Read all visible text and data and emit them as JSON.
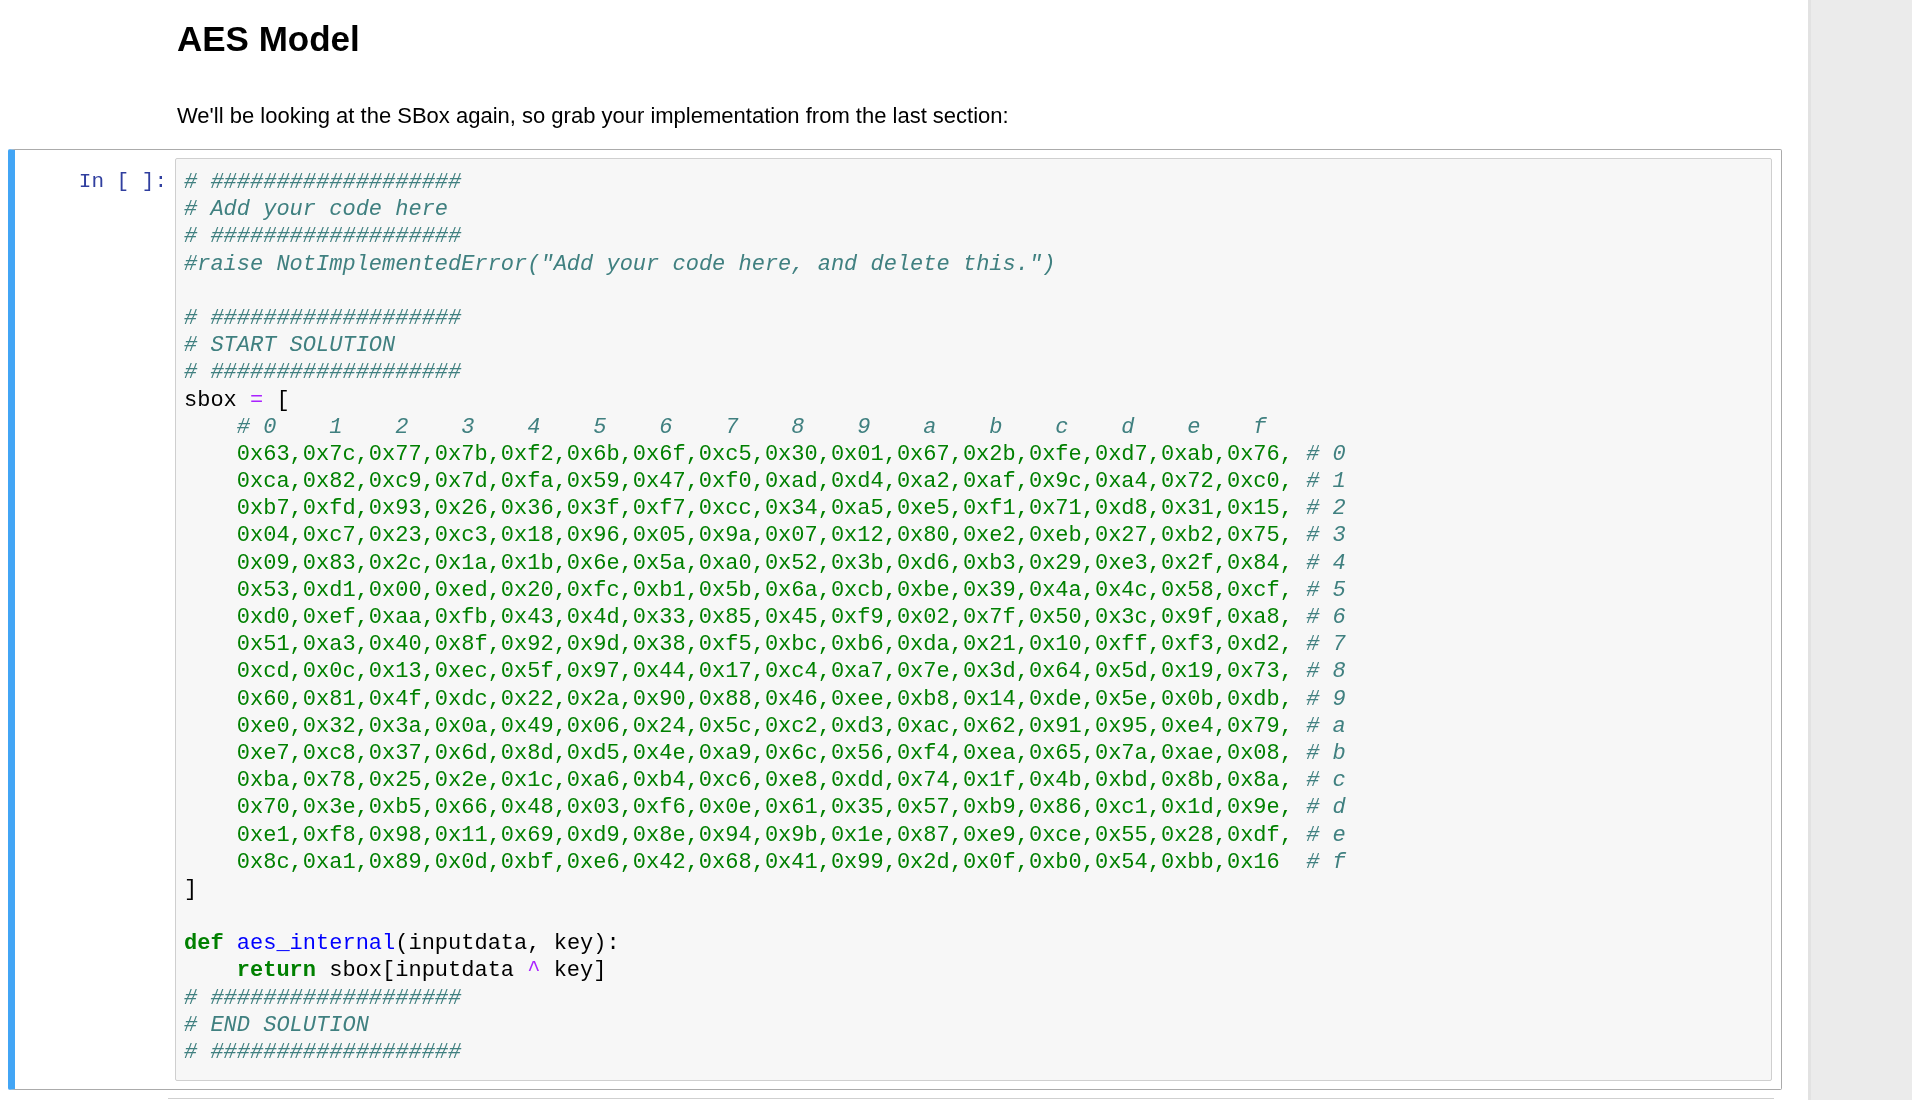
{
  "heading": "AES Model",
  "paragraph": "We'll be looking at the SBox again, so grab your implementation from the last section:",
  "cell": {
    "prompt": "In [ ]:",
    "active": true,
    "blocks": [
      {
        "lines": [
          {
            "segments": [
              {
                "kind": "comment",
                "text": "# ###################"
              }
            ]
          },
          {
            "segments": [
              {
                "kind": "comment",
                "text": "# Add your code here"
              }
            ]
          },
          {
            "segments": [
              {
                "kind": "comment",
                "text": "# ###################"
              }
            ]
          },
          {
            "segments": [
              {
                "kind": "comment",
                "text": "#raise NotImplementedError(\"Add your code here, and delete this.\")"
              }
            ]
          }
        ]
      },
      {
        "lines": [
          {
            "segments": [
              {
                "kind": "comment",
                "text": "# ###################"
              }
            ]
          },
          {
            "segments": [
              {
                "kind": "comment",
                "text": "# START SOLUTION"
              }
            ]
          },
          {
            "segments": [
              {
                "kind": "comment",
                "text": "# ###################"
              }
            ]
          },
          {
            "segments": [
              {
                "kind": "plain",
                "text": "sbox "
              },
              {
                "kind": "operator",
                "text": "="
              },
              {
                "kind": "plain",
                "text": " ["
              }
            ]
          },
          {
            "indent": true,
            "segments": [
              {
                "kind": "comment",
                "text": "# 0    1    2    3    4    5    6    7    8    9    a    b    c    d    e    f"
              }
            ]
          },
          {
            "indent": true,
            "segments": [
              {
                "kind": "number",
                "text": "0x63,0x7c,0x77,0x7b,0xf2,0x6b,0x6f,0xc5,0x30,0x01,0x67,0x2b,0xfe,0xd7,0xab,0x76, "
              },
              {
                "kind": "comment",
                "text": "# 0"
              }
            ]
          },
          {
            "indent": true,
            "segments": [
              {
                "kind": "number",
                "text": "0xca,0x82,0xc9,0x7d,0xfa,0x59,0x47,0xf0,0xad,0xd4,0xa2,0xaf,0x9c,0xa4,0x72,0xc0, "
              },
              {
                "kind": "comment",
                "text": "# 1"
              }
            ]
          },
          {
            "indent": true,
            "segments": [
              {
                "kind": "number",
                "text": "0xb7,0xfd,0x93,0x26,0x36,0x3f,0xf7,0xcc,0x34,0xa5,0xe5,0xf1,0x71,0xd8,0x31,0x15, "
              },
              {
                "kind": "comment",
                "text": "# 2"
              }
            ]
          },
          {
            "indent": true,
            "segments": [
              {
                "kind": "number",
                "text": "0x04,0xc7,0x23,0xc3,0x18,0x96,0x05,0x9a,0x07,0x12,0x80,0xe2,0xeb,0x27,0xb2,0x75, "
              },
              {
                "kind": "comment",
                "text": "# 3"
              }
            ]
          },
          {
            "indent": true,
            "segments": [
              {
                "kind": "number",
                "text": "0x09,0x83,0x2c,0x1a,0x1b,0x6e,0x5a,0xa0,0x52,0x3b,0xd6,0xb3,0x29,0xe3,0x2f,0x84, "
              },
              {
                "kind": "comment",
                "text": "# 4"
              }
            ]
          },
          {
            "indent": true,
            "segments": [
              {
                "kind": "number",
                "text": "0x53,0xd1,0x00,0xed,0x20,0xfc,0xb1,0x5b,0x6a,0xcb,0xbe,0x39,0x4a,0x4c,0x58,0xcf, "
              },
              {
                "kind": "comment",
                "text": "# 5"
              }
            ]
          },
          {
            "indent": true,
            "segments": [
              {
                "kind": "number",
                "text": "0xd0,0xef,0xaa,0xfb,0x43,0x4d,0x33,0x85,0x45,0xf9,0x02,0x7f,0x50,0x3c,0x9f,0xa8, "
              },
              {
                "kind": "comment",
                "text": "# 6"
              }
            ]
          },
          {
            "indent": true,
            "segments": [
              {
                "kind": "number",
                "text": "0x51,0xa3,0x40,0x8f,0x92,0x9d,0x38,0xf5,0xbc,0xb6,0xda,0x21,0x10,0xff,0xf3,0xd2, "
              },
              {
                "kind": "comment",
                "text": "# 7"
              }
            ]
          },
          {
            "indent": true,
            "segments": [
              {
                "kind": "number",
                "text": "0xcd,0x0c,0x13,0xec,0x5f,0x97,0x44,0x17,0xc4,0xa7,0x7e,0x3d,0x64,0x5d,0x19,0x73, "
              },
              {
                "kind": "comment",
                "text": "# 8"
              }
            ]
          },
          {
            "indent": true,
            "segments": [
              {
                "kind": "number",
                "text": "0x60,0x81,0x4f,0xdc,0x22,0x2a,0x90,0x88,0x46,0xee,0xb8,0x14,0xde,0x5e,0x0b,0xdb, "
              },
              {
                "kind": "comment",
                "text": "# 9"
              }
            ]
          },
          {
            "indent": true,
            "segments": [
              {
                "kind": "number",
                "text": "0xe0,0x32,0x3a,0x0a,0x49,0x06,0x24,0x5c,0xc2,0xd3,0xac,0x62,0x91,0x95,0xe4,0x79, "
              },
              {
                "kind": "comment",
                "text": "# a"
              }
            ]
          },
          {
            "indent": true,
            "segments": [
              {
                "kind": "number",
                "text": "0xe7,0xc8,0x37,0x6d,0x8d,0xd5,0x4e,0xa9,0x6c,0x56,0xf4,0xea,0x65,0x7a,0xae,0x08, "
              },
              {
                "kind": "comment",
                "text": "# b"
              }
            ]
          },
          {
            "indent": true,
            "segments": [
              {
                "kind": "number",
                "text": "0xba,0x78,0x25,0x2e,0x1c,0xa6,0xb4,0xc6,0xe8,0xdd,0x74,0x1f,0x4b,0xbd,0x8b,0x8a, "
              },
              {
                "kind": "comment",
                "text": "# c"
              }
            ]
          },
          {
            "indent": true,
            "segments": [
              {
                "kind": "number",
                "text": "0x70,0x3e,0xb5,0x66,0x48,0x03,0xf6,0x0e,0x61,0x35,0x57,0xb9,0x86,0xc1,0x1d,0x9e, "
              },
              {
                "kind": "comment",
                "text": "# d"
              }
            ]
          },
          {
            "indent": true,
            "segments": [
              {
                "kind": "number",
                "text": "0xe1,0xf8,0x98,0x11,0x69,0xd9,0x8e,0x94,0x9b,0x1e,0x87,0xe9,0xce,0x55,0x28,0xdf, "
              },
              {
                "kind": "comment",
                "text": "# e"
              }
            ]
          },
          {
            "indent": true,
            "segments": [
              {
                "kind": "number",
                "text": "0x8c,0xa1,0x89,0x0d,0xbf,0xe6,0x42,0x68,0x41,0x99,0x2d,0x0f,0xb0,0x54,0xbb,0x16  "
              },
              {
                "kind": "comment",
                "text": "# f"
              }
            ]
          },
          {
            "segments": [
              {
                "kind": "plain",
                "text": "]"
              }
            ]
          }
        ]
      },
      {
        "lines": [
          {
            "segments": [
              {
                "kind": "keyword",
                "text": "def "
              },
              {
                "kind": "function",
                "text": "aes_internal"
              },
              {
                "kind": "plain",
                "text": "(inputdata, key):"
              }
            ]
          },
          {
            "indent": true,
            "segments": [
              {
                "kind": "keyword",
                "text": "return"
              },
              {
                "kind": "plain",
                "text": " sbox[inputdata "
              },
              {
                "kind": "operator",
                "text": "^"
              },
              {
                "kind": "plain",
                "text": " key]"
              }
            ]
          },
          {
            "segments": [
              {
                "kind": "comment",
                "text": "# ###################"
              }
            ]
          },
          {
            "segments": [
              {
                "kind": "comment",
                "text": "# END SOLUTION"
              }
            ]
          },
          {
            "segments": [
              {
                "kind": "comment",
                "text": "# ###################"
              }
            ]
          }
        ]
      }
    ]
  }
}
